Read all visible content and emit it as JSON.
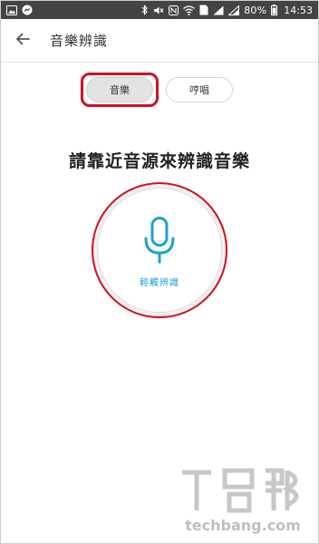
{
  "status_bar": {
    "battery_percent": "80%",
    "time": "14:53",
    "sim_label": "1"
  },
  "app_bar": {
    "title": "音樂辨識"
  },
  "mode_toggle": {
    "music_label": "音樂",
    "hum_label": "哼唱",
    "selected": "music"
  },
  "prompt": "請靠近音源來辨識音樂",
  "recognize": {
    "label": "輕觸辨識"
  },
  "watermark": {
    "text": "techbang.com"
  },
  "colors": {
    "accent": "#1e9fd6",
    "highlight": "#d50f1f",
    "status_bar": "#444444"
  }
}
